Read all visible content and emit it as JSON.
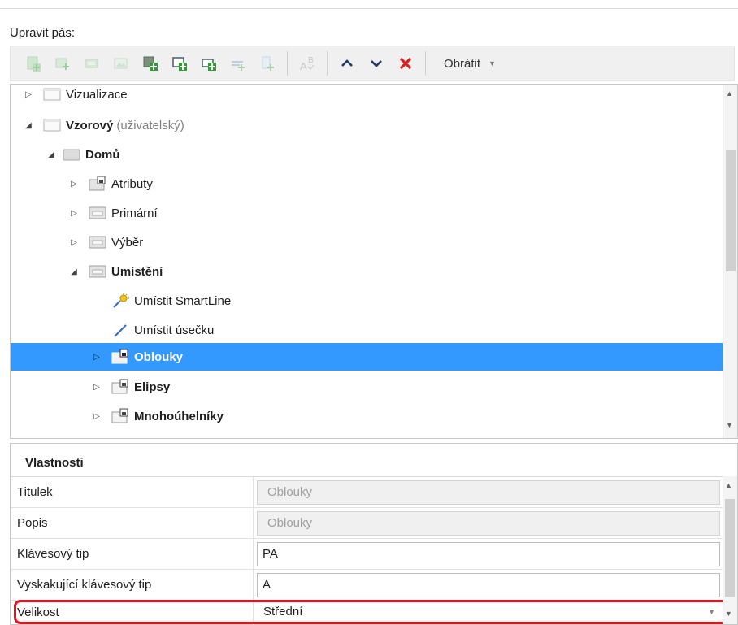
{
  "edit_ribbon_label": "Upravit pás:",
  "toolbar": {
    "buttons": [
      {
        "icon": "add-tab-icon",
        "enabled": false
      },
      {
        "icon": "add-group-icon",
        "enabled": false
      },
      {
        "icon": "add-subgroup-icon",
        "enabled": false
      },
      {
        "icon": "add-image-icon",
        "enabled": false
      },
      {
        "icon": "add-element-icon",
        "enabled": true
      },
      {
        "icon": "add-child-icon",
        "enabled": true
      },
      {
        "icon": "add-item-icon",
        "enabled": true
      },
      {
        "icon": "add-separator-icon",
        "enabled": false
      },
      {
        "icon": "add-split-icon",
        "enabled": false
      },
      {
        "icon": "rename-ab-icon",
        "enabled": false
      },
      {
        "icon": "move-up-icon",
        "enabled": true
      },
      {
        "icon": "move-down-icon",
        "enabled": true
      },
      {
        "icon": "delete-icon",
        "enabled": true
      }
    ],
    "reverse_label": "Obrátit"
  },
  "tree": {
    "items": [
      {
        "label": "Vizualizace",
        "sub": "",
        "bold": false,
        "expanded": false
      },
      {
        "label": "Vzorový",
        "sub": "(uživatelský)",
        "bold": true,
        "expanded": true
      },
      {
        "label": "Domů",
        "sub": "",
        "bold": true,
        "expanded": true
      },
      {
        "label": "Atributy",
        "sub": "",
        "bold": false,
        "expanded": false
      },
      {
        "label": "Primární",
        "sub": "",
        "bold": false,
        "expanded": false
      },
      {
        "label": "Výběr",
        "sub": "",
        "bold": false,
        "expanded": false
      },
      {
        "label": "Umístění",
        "sub": "",
        "bold": true,
        "expanded": true
      },
      {
        "label": "Umístit SmartLine",
        "sub": "",
        "bold": false
      },
      {
        "label": "Umístit úsečku",
        "sub": "",
        "bold": false
      },
      {
        "label": "Oblouky",
        "sub": "",
        "bold": true,
        "expanded": false,
        "selected": true
      },
      {
        "label": "Elipsy",
        "sub": "",
        "bold": true,
        "expanded": false
      },
      {
        "label": "Mnohoúhelníky",
        "sub": "",
        "bold": true,
        "expanded": false
      }
    ]
  },
  "properties": {
    "title": "Vlastnosti",
    "rows": [
      {
        "name": "Titulek",
        "value": "Oblouky",
        "readonly": true
      },
      {
        "name": "Popis",
        "value": "Oblouky",
        "readonly": true
      },
      {
        "name": "Klávesový tip",
        "value": "PA",
        "readonly": false
      },
      {
        "name": "Vyskakující klávesový tip",
        "value": "A",
        "readonly": false
      },
      {
        "name": "Velikost",
        "value": "Střední",
        "readonly": false,
        "dropdown": true
      }
    ]
  },
  "colors": {
    "selection": "#3399ff",
    "highlight": "#e8121b",
    "green_plus": "#2e9e2e",
    "delete_red": "#e01b1b",
    "arrow_navy": "#1b3a6b"
  }
}
